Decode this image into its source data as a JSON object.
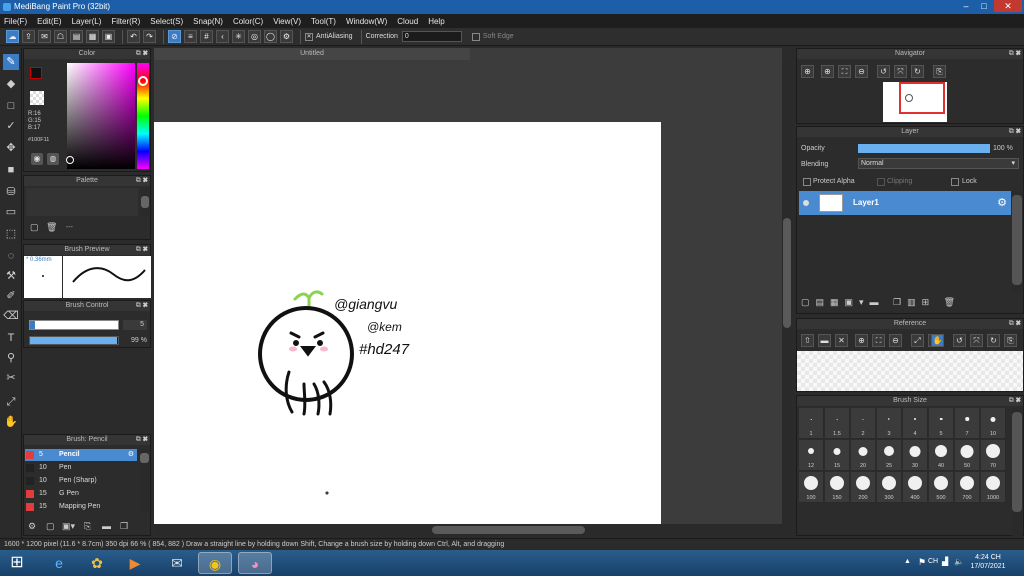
{
  "app": {
    "title": "MediBang Paint Pro (32bit)",
    "window_controls": [
      "–",
      "□",
      "✕"
    ]
  },
  "menu": [
    "File(F)",
    "Edit(E)",
    "Layer(L)",
    "Filter(R)",
    "Select(S)",
    "Snap(N)",
    "Color(C)",
    "View(V)",
    "Tool(T)",
    "Window(W)",
    "Cloud",
    "Help"
  ],
  "toolbar": {
    "antialiasing_label": "AntiAliasing",
    "correction_label": "Correction",
    "correction_value": "0",
    "soft_edge_label": "Soft Edge"
  },
  "color_panel": {
    "title": "Color",
    "r": "R:16",
    "g": "G:15",
    "b": "B:17",
    "hex": "#100F11",
    "fg_color": "#100F11"
  },
  "palette_panel": {
    "title": "Palette",
    "dash": "---"
  },
  "brush_preview_panel": {
    "title": "Brush Preview",
    "size": "* 0.36mm"
  },
  "brush_control_panel": {
    "title": "Brush Control",
    "size_value": "5",
    "opacity_value": "99 %",
    "opacity_fraction": 0.99
  },
  "brush_panel": {
    "title": "Brush: Pencil",
    "items": [
      {
        "size": "5",
        "name": "Pencil",
        "color": "#e23c3c"
      },
      {
        "size": "10",
        "name": "Pen",
        "color": "#222222"
      },
      {
        "size": "10",
        "name": "Pen (Sharp)",
        "color": "#222222"
      },
      {
        "size": "15",
        "name": "G Pen",
        "color": "#e23c3c"
      },
      {
        "size": "15",
        "name": "Mapping Pen",
        "color": "#e23c3c"
      }
    ]
  },
  "document": {
    "tab_title": "Untitled"
  },
  "canvas_text": {
    "line1": "@giangvu",
    "line2": "@kem",
    "line3": "#hd247"
  },
  "navigator_panel": {
    "title": "Navigator"
  },
  "layer_panel": {
    "title": "Layer",
    "opacity_label": "Opacity",
    "opacity_value": "100 %",
    "blending_label": "Blending",
    "blending_value": "Normal",
    "protect_alpha": "Protect Alpha",
    "clipping": "Clipping",
    "lock": "Lock",
    "layer_name": "Layer1"
  },
  "reference_panel": {
    "title": "Reference"
  },
  "brush_size_panel": {
    "title": "Brush Size",
    "sizes": [
      "1",
      "1.5",
      "2",
      "3",
      "4",
      "5",
      "7",
      "10",
      "12",
      "15",
      "20",
      "25",
      "30",
      "40",
      "50",
      "70",
      "100",
      "150",
      "200",
      "300",
      "400",
      "500",
      "700",
      "1000"
    ]
  },
  "status_bar": {
    "text": "1600 * 1200 pixel  (11.6 * 8.7cm)  350 dpi  66 %  ( 854, 882 )  Draw a straight line by holding down Shift, Change a brush size by holding down Ctrl, Alt, and dragging"
  },
  "taskbar": {
    "language": "CH",
    "time": "4:24 CH",
    "date": "17/07/2021"
  }
}
